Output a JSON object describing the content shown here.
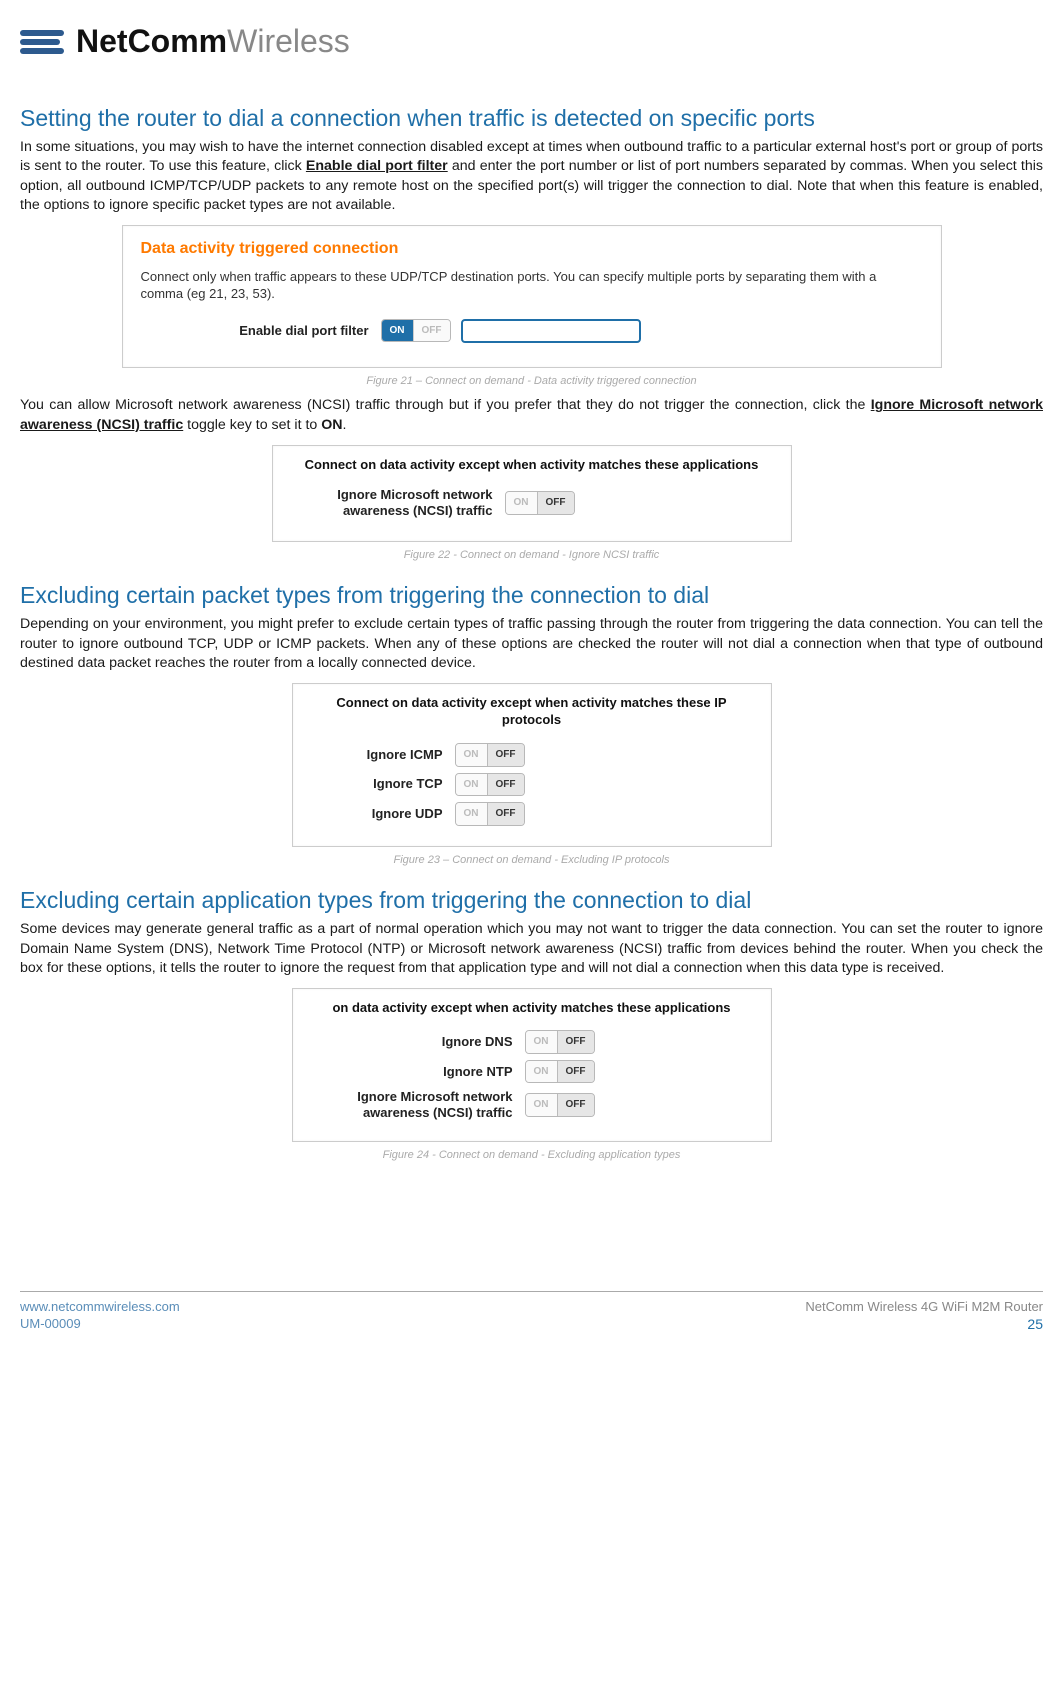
{
  "brand": {
    "name_bold": "NetComm",
    "name_light": "Wireless"
  },
  "section1": {
    "heading": "Setting the router to dial a connection when traffic is detected on specific ports",
    "p_before": "In some situations, you may wish to have the internet connection disabled except at times when outbound traffic to a particular external host's port or group of ports is sent to the router. To use this feature, click ",
    "p_strong": "Enable dial port filter",
    "p_after": " and enter the port number or list of port numbers separated by commas. When you select this option, all outbound ICMP/TCP/UDP packets to any remote host on the specified port(s) will trigger the connection to dial. Note that when this feature is enabled, the options to ignore specific packet types are not available."
  },
  "fig21": {
    "panel_title": "Data activity triggered connection",
    "panel_desc": "Connect only when traffic appears to these UDP/TCP destination ports. You can specify multiple ports by separating them with a comma (eg 21, 23, 53).",
    "row_label": "Enable dial port filter",
    "toggle": {
      "on": "ON",
      "off": "OFF",
      "state": "on"
    },
    "caption": "Figure 21 – Connect on demand - Data activity triggered connection"
  },
  "paragraph_between": {
    "before": "You can allow Microsoft network awareness (NCSI) traffic through but if you prefer that they do not trigger the connection, click the ",
    "strong": "Ignore Microsoft network awareness (NCSI) traffic",
    "mid": " toggle key to set it to ",
    "on_word": "ON",
    "after": "."
  },
  "fig22": {
    "header": "Connect on data activity except when activity matches these applications",
    "row_label": "Ignore Microsoft network awareness (NCSI) traffic",
    "toggle": {
      "on": "ON",
      "off": "OFF",
      "state": "off"
    },
    "caption": "Figure 22 - Connect on demand - Ignore NCSI traffic"
  },
  "section2": {
    "heading": "Excluding certain packet types from triggering the connection to dial",
    "p": "Depending on your environment, you might prefer to exclude certain types of traffic passing through the router from triggering the data connection. You can tell the router to ignore outbound TCP, UDP or ICMP packets. When any of these options are checked the router will not dial a connection when that type of outbound destined data packet reaches the router from a locally connected device."
  },
  "fig23": {
    "header": "Connect on data activity except when activity matches these IP protocols",
    "rows": [
      {
        "label": "Ignore ICMP",
        "state": "off"
      },
      {
        "label": "Ignore TCP",
        "state": "off"
      },
      {
        "label": "Ignore UDP",
        "state": "off"
      }
    ],
    "toggle_labels": {
      "on": "ON",
      "off": "OFF"
    },
    "caption": "Figure 23 – Connect on demand - Excluding IP protocols"
  },
  "section3": {
    "heading": "Excluding certain application types from triggering the connection to dial",
    "p": "Some devices may generate general traffic as a part of normal operation which you may not want to trigger the data connection. You can set the router to ignore Domain Name System (DNS), Network Time Protocol (NTP) or Microsoft network awareness (NCSI) traffic from devices behind the router. When you check the box for these options, it tells the router to ignore the request from that application type and will not dial a connection when this data type is received."
  },
  "fig24": {
    "header": "on data activity except when activity matches these applications",
    "rows": [
      {
        "label": "Ignore DNS",
        "state": "off"
      },
      {
        "label": "Ignore NTP",
        "state": "off"
      },
      {
        "label": "Ignore Microsoft network awareness (NCSI) traffic",
        "state": "off"
      }
    ],
    "toggle_labels": {
      "on": "ON",
      "off": "OFF"
    },
    "caption": "Figure 24 - Connect on demand - Excluding application types"
  },
  "footer": {
    "url": "www.netcommwireless.com",
    "docnum": "UM-00009",
    "product": "NetComm Wireless 4G WiFi M2M Router",
    "page": "25"
  }
}
